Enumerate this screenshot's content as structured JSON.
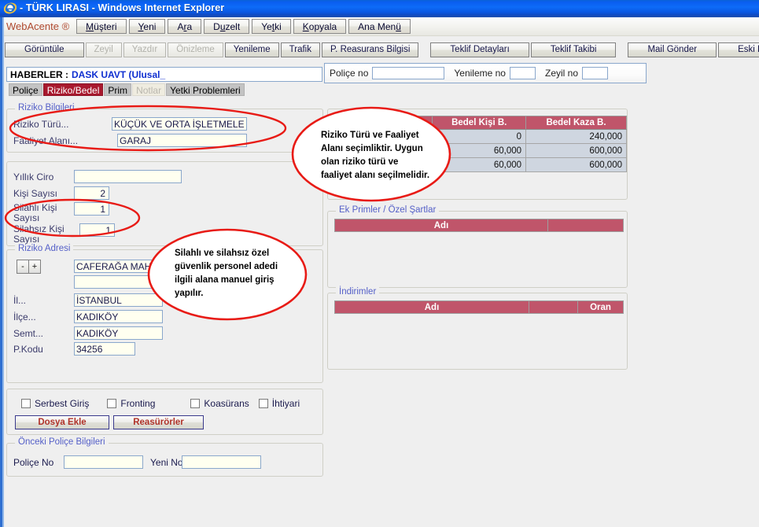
{
  "window": {
    "icon": "internet-explorer-icon",
    "title": "- TÜRK LIRASI - Windows Internet Explorer"
  },
  "menubar": {
    "brand": "WebAcente ®",
    "items": [
      {
        "label": "Müşteri",
        "accel": "M"
      },
      {
        "label": "Yeni",
        "accel": "Y"
      },
      {
        "label": "Ara",
        "accel": "r"
      },
      {
        "label": "Duzelt",
        "accel": "u"
      },
      {
        "label": "Yetki",
        "accel": "t"
      },
      {
        "label": "Kopyala",
        "accel": "K"
      },
      {
        "label": "Ana Menü",
        "accel": "ü"
      }
    ]
  },
  "toolbar": {
    "buttons": [
      {
        "label": "Görüntüle",
        "disabled": false
      },
      {
        "label": "Zeyil",
        "disabled": true
      },
      {
        "label": "Yazdır",
        "disabled": true
      },
      {
        "label": "Önizleme",
        "disabled": true
      },
      {
        "label": "Yenileme",
        "disabled": false
      },
      {
        "label": "Trafik",
        "disabled": false
      },
      {
        "label": "P. Reasurans Bilgisi",
        "disabled": false
      },
      {
        "label": "Teklif Detayları",
        "disabled": false
      },
      {
        "label": "Teklif Takibi",
        "disabled": false
      },
      {
        "label": "Mail Gönder",
        "disabled": false
      },
      {
        "label": "Eski Hasar",
        "disabled": false
      }
    ]
  },
  "haberler": {
    "label": "HABERLER :",
    "value": "DASK UAVT (Ulusal_"
  },
  "tabs": [
    {
      "label": "Poliçe",
      "state": "normal"
    },
    {
      "label": "Riziko/Bedel",
      "state": "active"
    },
    {
      "label": "Prim",
      "state": "normal"
    },
    {
      "label": "Notlar",
      "state": "disabled"
    },
    {
      "label": "Yetki Problemleri",
      "state": "normal"
    }
  ],
  "policy_bar": {
    "police_no_label": "Poliçe no",
    "police_no_value": "",
    "yenileme_no_label": "Yenileme no",
    "yenileme_no_value": "",
    "zeyil_no_label": "Zeyil no",
    "zeyil_no_value": ""
  },
  "riziko_bilgileri": {
    "legend": "Riziko Bilgileri",
    "fields": [
      {
        "label": "Riziko Türü...",
        "value": "KÜÇÜK VE ORTA İŞLETMELER"
      },
      {
        "label": "Faaliyet Alanı...",
        "value": "GARAJ"
      }
    ]
  },
  "sayilar": {
    "fields": [
      {
        "label": "Yıllık Ciro",
        "value": ""
      },
      {
        "label": "Kişi Sayısı",
        "value": "2"
      },
      {
        "label": "Silahlı Kişi Sayısı",
        "value": "1"
      },
      {
        "label": "Silahsız Kişi Sayısı",
        "value": "1"
      }
    ]
  },
  "riziko_adresi": {
    "legend": "Riziko Adresi",
    "minus_label": "-",
    "plus_label": "+",
    "mahalle": "CAFERAĞA MAH.",
    "sokak": "",
    "fields": [
      {
        "label": "İl...",
        "value": "İSTANBUL"
      },
      {
        "label": "İlçe...",
        "value": "KADIKÖY"
      },
      {
        "label": "Semt...",
        "value": "KADIKÖY"
      },
      {
        "label": "P.Kodu",
        "value": "34256"
      }
    ]
  },
  "options": {
    "checkboxes": [
      {
        "label": "Serbest Giriş",
        "checked": false
      },
      {
        "label": "Fronting",
        "checked": false
      },
      {
        "label": "Koasürans",
        "checked": false
      },
      {
        "label": "İhtiyari",
        "checked": false
      }
    ],
    "buttons": [
      {
        "label": "Dosya Ekle"
      },
      {
        "label": "Reasürörler"
      }
    ]
  },
  "onceki_police": {
    "legend": "Önceki Poliçe Bilgileri",
    "police_no_label": "Poliçe No",
    "police_no_value": "",
    "yeni_no_label": "Yeni No",
    "yeni_no_value": ""
  },
  "bedel_table": {
    "headers": [
      "Bedel Kişi B.",
      "Bedel Kaza B."
    ],
    "rows": [
      [
        "0",
        "240,000"
      ],
      [
        "60,000",
        "600,000"
      ],
      [
        "60,000",
        "600,000"
      ]
    ]
  },
  "ek_primler": {
    "legend": "Ek Primler / Özel Şartlar",
    "headers": [
      "Adı",
      ""
    ],
    "rows": []
  },
  "indirimler": {
    "legend": "İndirimler",
    "headers": [
      "Adı",
      "",
      "Oran"
    ],
    "rows": []
  },
  "annotations": {
    "color": "#e81b16",
    "note1": "Riziko Türü ve Faaliyet\nAlanı seçimliktir. Uygun\nolan riziko türü ve\nfaaliyet alanı seçilmelidir.",
    "note2": "Silahlı ve silahsız özel\ngüvenlik personel adedi\nilgili alana manuel giriş\nyapılır."
  }
}
